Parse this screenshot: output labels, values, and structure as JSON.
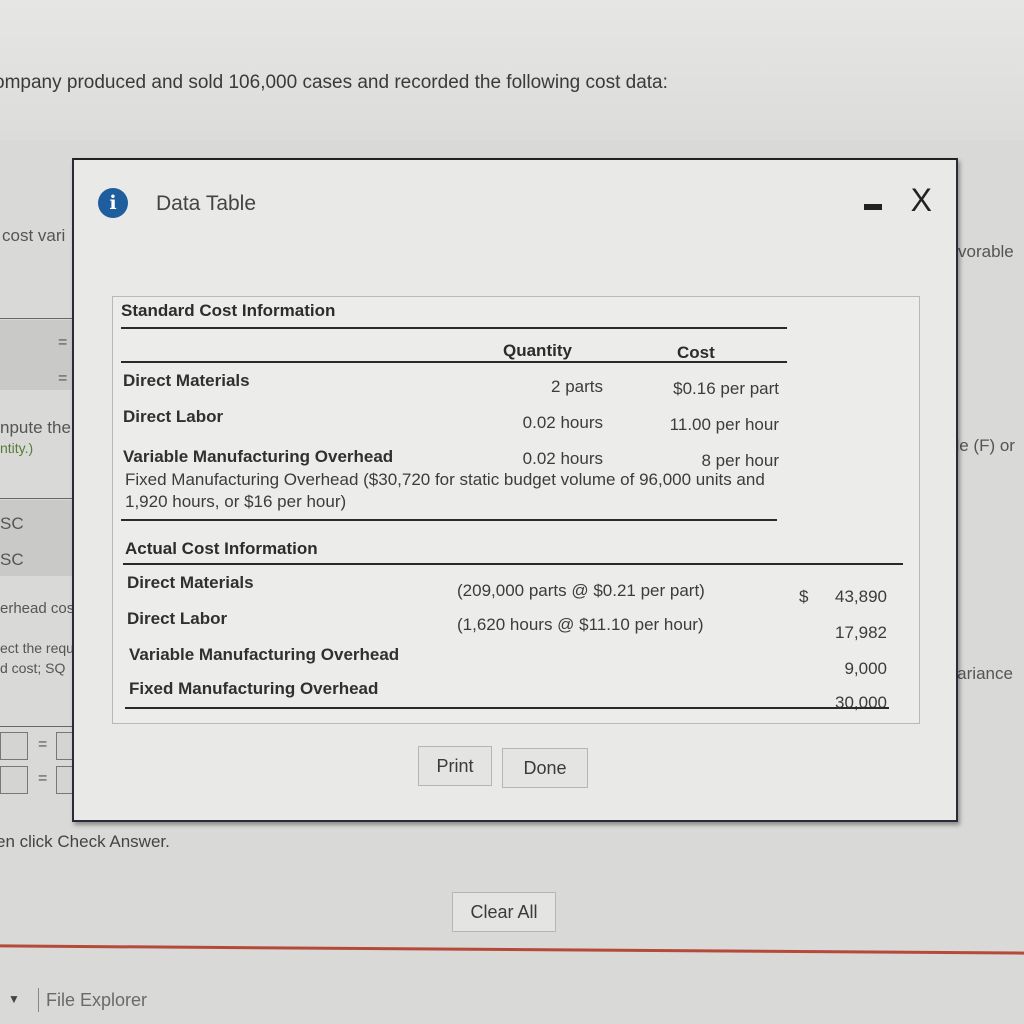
{
  "background": {
    "intro_text": "ompany produced and sold 106,000 cases and recorded the following cost data:",
    "left_fragments": [
      "cost vari",
      "npute the",
      "ntity.)",
      "SC",
      "SC",
      "erhead cos",
      "ect the requ",
      "d cost; SQ"
    ],
    "right_fragments": [
      "vorable",
      "ble (F) or",
      "ch variance"
    ],
    "instruction_text": "en click Check Answer.",
    "clear_all_label": "Clear All",
    "taskbar": {
      "file_explorer_label": "File Explorer"
    }
  },
  "dialog": {
    "title": "Data Table",
    "icons": {
      "info": "info-icon",
      "minimize": "minimize-icon",
      "close": "close-icon"
    },
    "close_glyph": "X",
    "standard": {
      "title": "Standard Cost Information",
      "headers": {
        "quantity": "Quantity",
        "cost": "Cost"
      },
      "rows": [
        {
          "label": "Direct Materials",
          "quantity": "2 parts",
          "cost": "$0.16 per part"
        },
        {
          "label": "Direct Labor",
          "quantity": "0.02 hours",
          "cost": "11.00 per hour"
        },
        {
          "label": "Variable Manufacturing Overhead",
          "quantity": "0.02 hours",
          "cost": "8 per hour"
        }
      ],
      "fixed_note": "Fixed Manufacturing Overhead ($30,720 for static budget volume of 96,000 units and 1,920 hours, or $16 per hour)"
    },
    "actual": {
      "title": "Actual Cost Information",
      "rows": [
        {
          "label": "Direct Materials",
          "detail": "(209,000 parts @ $0.21 per part)",
          "currency": "$",
          "amount": "43,890"
        },
        {
          "label": "Direct Labor",
          "detail": "(1,620 hours @ $11.10 per hour)",
          "currency": "",
          "amount": "17,982"
        },
        {
          "label": "Variable Manufacturing Overhead",
          "detail": "",
          "currency": "",
          "amount": "9,000"
        },
        {
          "label": "Fixed Manufacturing Overhead",
          "detail": "",
          "currency": "",
          "amount": "30,000"
        }
      ]
    },
    "buttons": {
      "print": "Print",
      "done": "Done"
    }
  }
}
